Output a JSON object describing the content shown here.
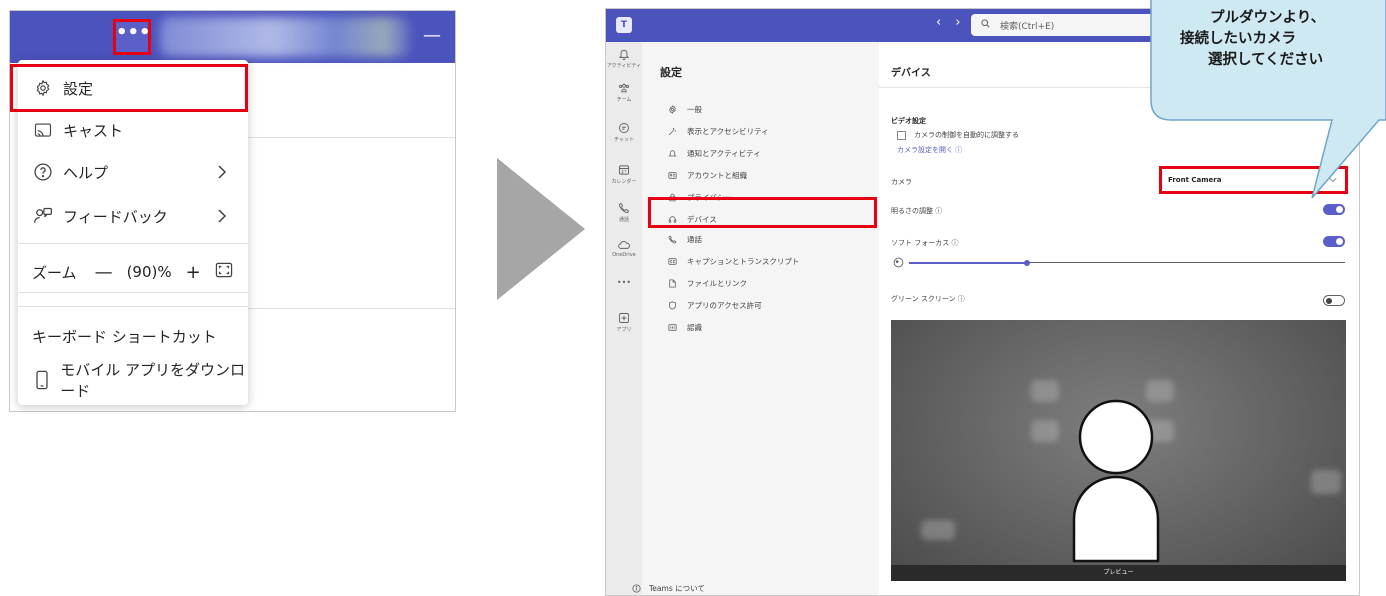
{
  "left_panel": {
    "menu": {
      "settings": "設定",
      "cast": "キャスト",
      "help": "ヘルプ",
      "feedback": "フィードバック",
      "zoom_label": "ズーム",
      "zoom_minus": "—",
      "zoom_value": "(90)%",
      "zoom_plus": "+",
      "keyboard_shortcuts": "キーボード ショートカット",
      "download_mobile": "モバイル アプリをダウンロード"
    }
  },
  "right_panel": {
    "search_placeholder": "検索(Ctrl+E)",
    "rail": {
      "activity": "アクティビティ",
      "teams": "チーム",
      "chat": "チャット",
      "calendar": "カレンダー",
      "calls": "通話",
      "onedrive": "OneDrive",
      "more": "•••",
      "apps": "アプリ"
    },
    "settings_title": "設定",
    "nav": [
      {
        "label": "一般"
      },
      {
        "label": "表示とアクセシビリティ"
      },
      {
        "label": "通知とアクティビティ"
      },
      {
        "label": "アカウントと組織"
      },
      {
        "label": "プライバシー"
      },
      {
        "label": "デバイス"
      },
      {
        "label": "通話"
      },
      {
        "label": "キャプションとトランスクリプト"
      },
      {
        "label": "ファイルとリンク"
      },
      {
        "label": "アプリのアクセス許可"
      },
      {
        "label": "認識"
      }
    ],
    "about": "Teams について",
    "content": {
      "title": "デバイス",
      "video_settings": "ビデオ設定",
      "auto_adjust": "カメラの制御を自動的に調整する",
      "open_camera_settings": "カメラ設定を開く ⓘ",
      "camera_label": "カメラ",
      "camera_selected": "Front Camera",
      "brightness": "明るさの調整 ⓘ",
      "brightness_on": true,
      "soft_focus": "ソフト フォーカス ⓘ",
      "soft_focus_on": true,
      "soft_focus_level": 0.27,
      "green_screen": "グリーン スクリーン ⓘ",
      "green_screen_on": false,
      "preview": "プレビュー"
    }
  },
  "callout": {
    "line1": "プルダウンより、",
    "line2": "接続したいカメラ",
    "line3": "選択してください"
  },
  "colors": {
    "teams_purple": "#4b53bc",
    "accent": "#5b5fc7",
    "highlight_red": "#e60012",
    "callout_fill": "#cfe9f3",
    "callout_border": "#6fa6c8",
    "arrow_gray": "#a6a6a6"
  }
}
